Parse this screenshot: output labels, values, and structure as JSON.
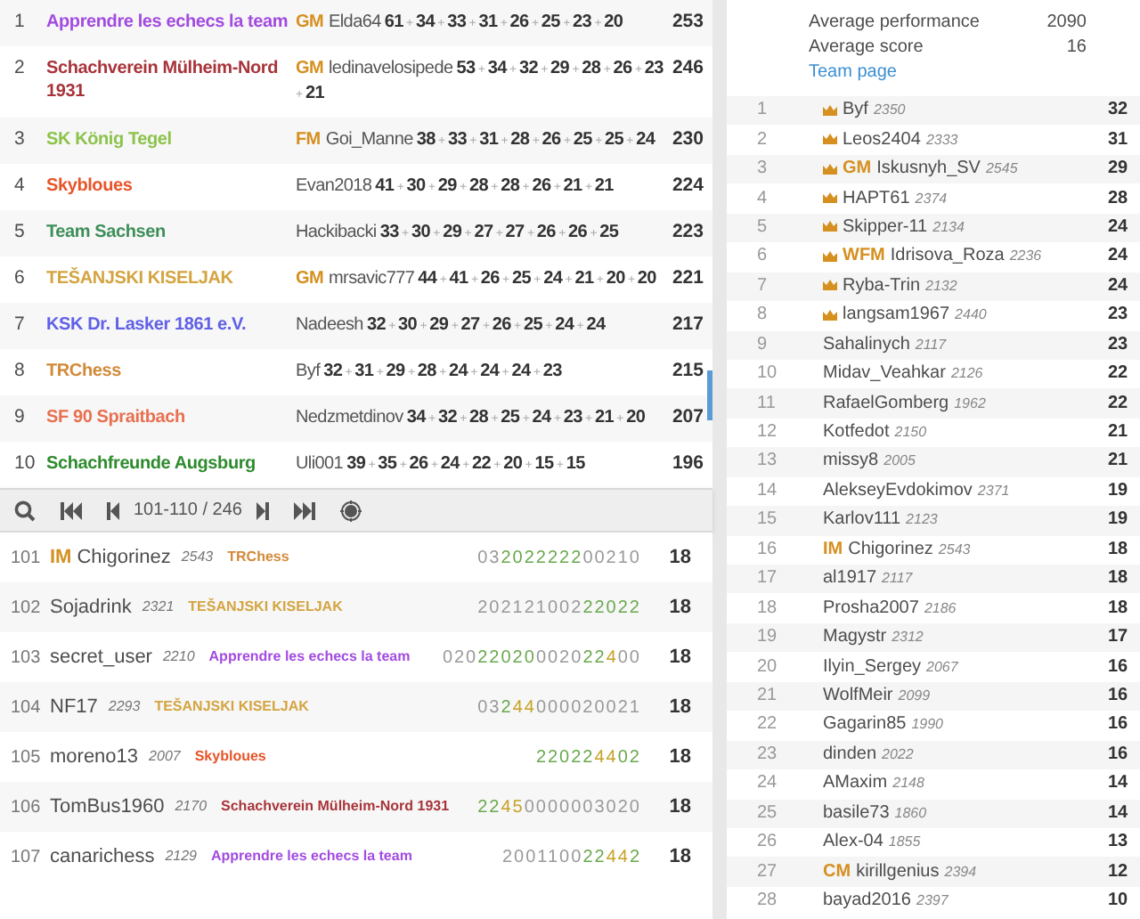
{
  "teams": [
    {
      "rank": "1",
      "name": "Apprendre les echecs la team",
      "color": "#a24be0",
      "leader": {
        "title": "GM",
        "name": "Elda64"
      },
      "scores": "**61** + **34** + **33** + **31** + **26** + **25** + **23** + **20**",
      "total": "253"
    },
    {
      "rank": "2",
      "name": "Schachverein Mülheim-Nord 1931",
      "color": "#a8343a",
      "leader": {
        "title": "GM",
        "name": "ledinavelosipede"
      },
      "scores": "**53** + **34** + **32** + **29** + **28** + **26** + **23** + **21**",
      "total": "246"
    },
    {
      "rank": "3",
      "name": "SK König Tegel",
      "color": "#8cc34a",
      "leader": {
        "title": "FM",
        "name": "Goi_Manne"
      },
      "scores": "**38** + **33** + **31** + **28** + **26** + **25** + **25** + **24**",
      "total": "230"
    },
    {
      "rank": "4",
      "name": "Skybloues",
      "color": "#e8542a",
      "leader": {
        "name": "Evan2018"
      },
      "scores": "**41** + **30** + **29** + **28** + **28** + **26** + **21** + **21**",
      "total": "224"
    },
    {
      "rank": "5",
      "name": "Team Sachsen",
      "color": "#3d8f5a",
      "leader": {
        "name": "Hackibacki"
      },
      "scores": "**33** + **30** + **29** + **27** + **27** + **26** + **26** + **25**",
      "total": "223"
    },
    {
      "rank": "6",
      "name": "TEŠANJSKI KISELJAK",
      "color": "#d4a440",
      "leader": {
        "title": "GM",
        "name": "mrsavic777"
      },
      "scores": "**44** + **41** + **26** + **25** + **24** + **21** + **20** + **20**",
      "total": "221"
    },
    {
      "rank": "7",
      "name": "KSK Dr. Lasker 1861 e.V.",
      "color": "#6060e8",
      "leader": {
        "name": "Nadeesh"
      },
      "scores": "**32** + **30** + **29** + **27** + **26** + **25** + **24** + **24**",
      "total": "217"
    },
    {
      "rank": "8",
      "name": "TRChess",
      "color": "#d28a3a",
      "leader": {
        "name": "Byf"
      },
      "scores": "**32** + **31** + **29** + **28** + **24** + **24** + **24** + **23**",
      "total": "215"
    },
    {
      "rank": "9",
      "name": "SF 90 Spraitbach",
      "color": "#e87050",
      "leader": {
        "name": "Nedzmetdinov"
      },
      "scores": "**34** + **32** + **28** + **25** + **24** + **23** + **21** + **20**",
      "total": "207"
    },
    {
      "rank": "10",
      "name": "Schachfreunde Augsburg",
      "color": "#2e8b2e",
      "leader": {
        "name": "Uli001"
      },
      "scores": "**39** + **35** + **26** + **24** + **22** + **20** + **15** + **15**",
      "total": "196"
    }
  ],
  "pager": {
    "range": "101-110 / 246"
  },
  "players": [
    {
      "rank": "101",
      "title": "IM",
      "name": "Chigorinez",
      "rating": "2543",
      "team": {
        "name": "TRChess",
        "color": "#d28a3a"
      },
      "sheet": [
        {
          "kind": "plain",
          "text": "03"
        },
        {
          "kind": "streak",
          "text": "2022222"
        },
        {
          "kind": "plain",
          "text": "00210"
        }
      ],
      "total": "18"
    },
    {
      "rank": "102",
      "name": "Sojadrink",
      "rating": "2321",
      "team": {
        "name": "TEŠANJSKI KISELJAK",
        "color": "#d4a440"
      },
      "sheet": [
        {
          "kind": "plain",
          "text": "202121002"
        },
        {
          "kind": "streak",
          "text": "22022"
        }
      ],
      "total": "18"
    },
    {
      "rank": "103",
      "name": "secret_user",
      "rating": "2210",
      "team": {
        "name": "Apprendre les echecs la team",
        "color": "#a24be0"
      },
      "sheet": [
        {
          "kind": "plain",
          "text": "020"
        },
        {
          "kind": "streak",
          "text": "22020"
        },
        {
          "kind": "plain",
          "text": "0020"
        },
        {
          "kind": "streak",
          "text": "22"
        },
        {
          "kind": "double",
          "text": "4"
        },
        {
          "kind": "plain",
          "text": "00"
        }
      ],
      "total": "18"
    },
    {
      "rank": "104",
      "name": "NF17",
      "rating": "2293",
      "team": {
        "name": "TEŠANJSKI KISELJAK",
        "color": "#d4a440"
      },
      "sheet": [
        {
          "kind": "plain",
          "text": "03"
        },
        {
          "kind": "streak",
          "text": "2"
        },
        {
          "kind": "double",
          "text": "44"
        },
        {
          "kind": "plain",
          "text": "000020021"
        }
      ],
      "total": "18"
    },
    {
      "rank": "105",
      "name": "moreno13",
      "rating": "2007",
      "team": {
        "name": "Skybloues",
        "color": "#e8542a"
      },
      "sheet": [
        {
          "kind": "streak",
          "text": "22022"
        },
        {
          "kind": "double",
          "text": "44"
        },
        {
          "kind": "streak",
          "text": "02"
        }
      ],
      "total": "18"
    },
    {
      "rank": "106",
      "name": "TomBus1960",
      "rating": "2170",
      "team": {
        "name": "Schachverein Mülheim-Nord 1931",
        "color": "#a8343a"
      },
      "sheet": [
        {
          "kind": "streak",
          "text": "22"
        },
        {
          "kind": "double",
          "text": "45"
        },
        {
          "kind": "plain",
          "text": "0000003020"
        }
      ],
      "total": "18"
    },
    {
      "rank": "107",
      "name": "canarichess",
      "rating": "2129",
      "team": {
        "name": "Apprendre les echecs la team",
        "color": "#a24be0"
      },
      "sheet": [
        {
          "kind": "plain",
          "text": "2001100"
        },
        {
          "kind": "streak",
          "text": "22"
        },
        {
          "kind": "double",
          "text": "44"
        },
        {
          "kind": "streak",
          "text": "2"
        }
      ],
      "total": "18"
    }
  ],
  "team_info": {
    "stats": [
      {
        "label": "Average performance",
        "value": "2090"
      },
      {
        "label": "Average score",
        "value": "16"
      }
    ],
    "link": "Team page"
  },
  "members": [
    {
      "rank": "1",
      "leader": true,
      "name": "Byf",
      "rating": "2350",
      "score": "32"
    },
    {
      "rank": "2",
      "leader": true,
      "name": "Leos2404",
      "rating": "2333",
      "score": "31"
    },
    {
      "rank": "3",
      "leader": true,
      "title": "GM",
      "name": "Iskusnyh_SV",
      "rating": "2545",
      "score": "29"
    },
    {
      "rank": "4",
      "leader": true,
      "name": "HAPT61",
      "rating": "2374",
      "score": "28"
    },
    {
      "rank": "5",
      "leader": true,
      "name": "Skipper-11",
      "rating": "2134",
      "score": "24"
    },
    {
      "rank": "6",
      "leader": true,
      "title": "WFM",
      "name": "Idrisova_Roza",
      "rating": "2236",
      "score": "24"
    },
    {
      "rank": "7",
      "leader": true,
      "name": "Ryba-Trin",
      "rating": "2132",
      "score": "24"
    },
    {
      "rank": "8",
      "leader": true,
      "name": "langsam1967",
      "rating": "2440",
      "score": "23"
    },
    {
      "rank": "9",
      "leader": false,
      "name": "Sahalinych",
      "rating": "2117",
      "score": "23"
    },
    {
      "rank": "10",
      "leader": false,
      "name": "Midav_Veahkar",
      "rating": "2126",
      "score": "22"
    },
    {
      "rank": "11",
      "leader": false,
      "name": "RafaelGomberg",
      "rating": "1962",
      "score": "22"
    },
    {
      "rank": "12",
      "leader": false,
      "name": "Kotfedot",
      "rating": "2150",
      "score": "21"
    },
    {
      "rank": "13",
      "leader": false,
      "name": "missy8",
      "rating": "2005",
      "score": "21"
    },
    {
      "rank": "14",
      "leader": false,
      "name": "AlekseyEvdokimov",
      "rating": "2371",
      "score": "19"
    },
    {
      "rank": "15",
      "leader": false,
      "name": "Karlov111",
      "rating": "2123",
      "score": "19"
    },
    {
      "rank": "16",
      "leader": false,
      "title": "IM",
      "name": "Chigorinez",
      "rating": "2543",
      "score": "18"
    },
    {
      "rank": "17",
      "leader": false,
      "name": "al1917",
      "rating": "2117",
      "score": "18"
    },
    {
      "rank": "18",
      "leader": false,
      "name": "Prosha2007",
      "rating": "2186",
      "score": "18"
    },
    {
      "rank": "19",
      "leader": false,
      "name": "Magystr",
      "rating": "2312",
      "score": "17"
    },
    {
      "rank": "20",
      "leader": false,
      "name": "Ilyin_Sergey",
      "rating": "2067",
      "score": "16"
    },
    {
      "rank": "21",
      "leader": false,
      "name": "WolfMeir",
      "rating": "2099",
      "score": "16"
    },
    {
      "rank": "22",
      "leader": false,
      "name": "Gagarin85",
      "rating": "1990",
      "score": "16"
    },
    {
      "rank": "23",
      "leader": false,
      "name": "dinden",
      "rating": "2022",
      "score": "16"
    },
    {
      "rank": "24",
      "leader": false,
      "name": "AMaxim",
      "rating": "2148",
      "score": "14"
    },
    {
      "rank": "25",
      "leader": false,
      "name": "basile73",
      "rating": "1860",
      "score": "14"
    },
    {
      "rank": "26",
      "leader": false,
      "name": "Alex-04",
      "rating": "1855",
      "score": "13"
    },
    {
      "rank": "27",
      "leader": false,
      "title": "CM",
      "name": "kirillgenius",
      "rating": "2394",
      "score": "12"
    },
    {
      "rank": "28",
      "leader": false,
      "name": "bayad2016",
      "rating": "2397",
      "score": "10"
    }
  ]
}
